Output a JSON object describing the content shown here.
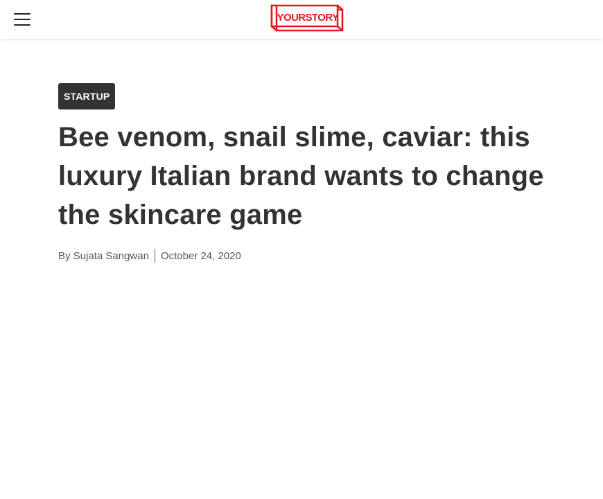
{
  "header": {
    "menu_icon": "hamburger-menu-icon",
    "logo_text": "YOURSTORY",
    "brand_color": "#e5161b"
  },
  "article": {
    "category": "STARTUP",
    "headline": "Bee venom, snail slime, caviar: this luxury Italian brand wants to change the skincare game",
    "byline_prefix": "By",
    "author": "Sujata Sangwan",
    "date": "October 24, 2020"
  }
}
